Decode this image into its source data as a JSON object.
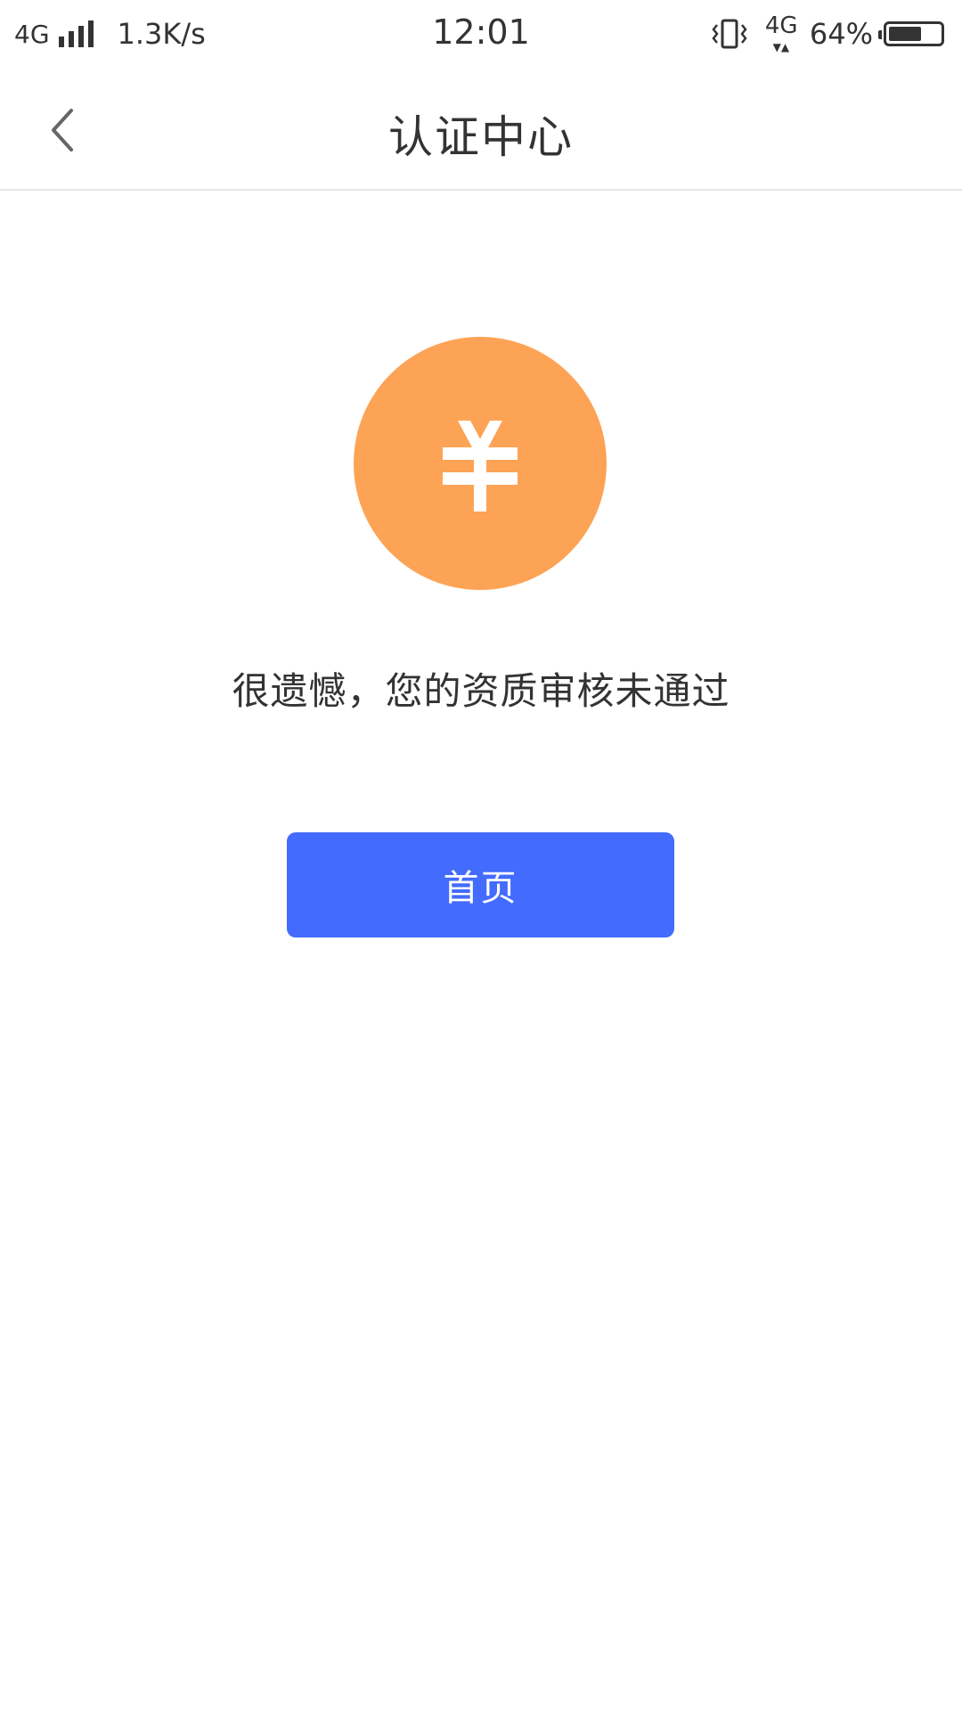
{
  "status_bar": {
    "network_type": "4G",
    "speed": "1.3K/s",
    "time": "12:01",
    "data_network": "4G",
    "battery_percent": "64%",
    "battery_level": 0.64
  },
  "nav": {
    "title": "认证中心",
    "back_icon": "chevron-left-icon"
  },
  "result": {
    "icon": "yuan-coin-icon",
    "icon_color": "#fda355",
    "message": "很遗憾，您的资质审核未通过"
  },
  "actions": {
    "home_label": "首页",
    "home_color": "#436bfd"
  }
}
